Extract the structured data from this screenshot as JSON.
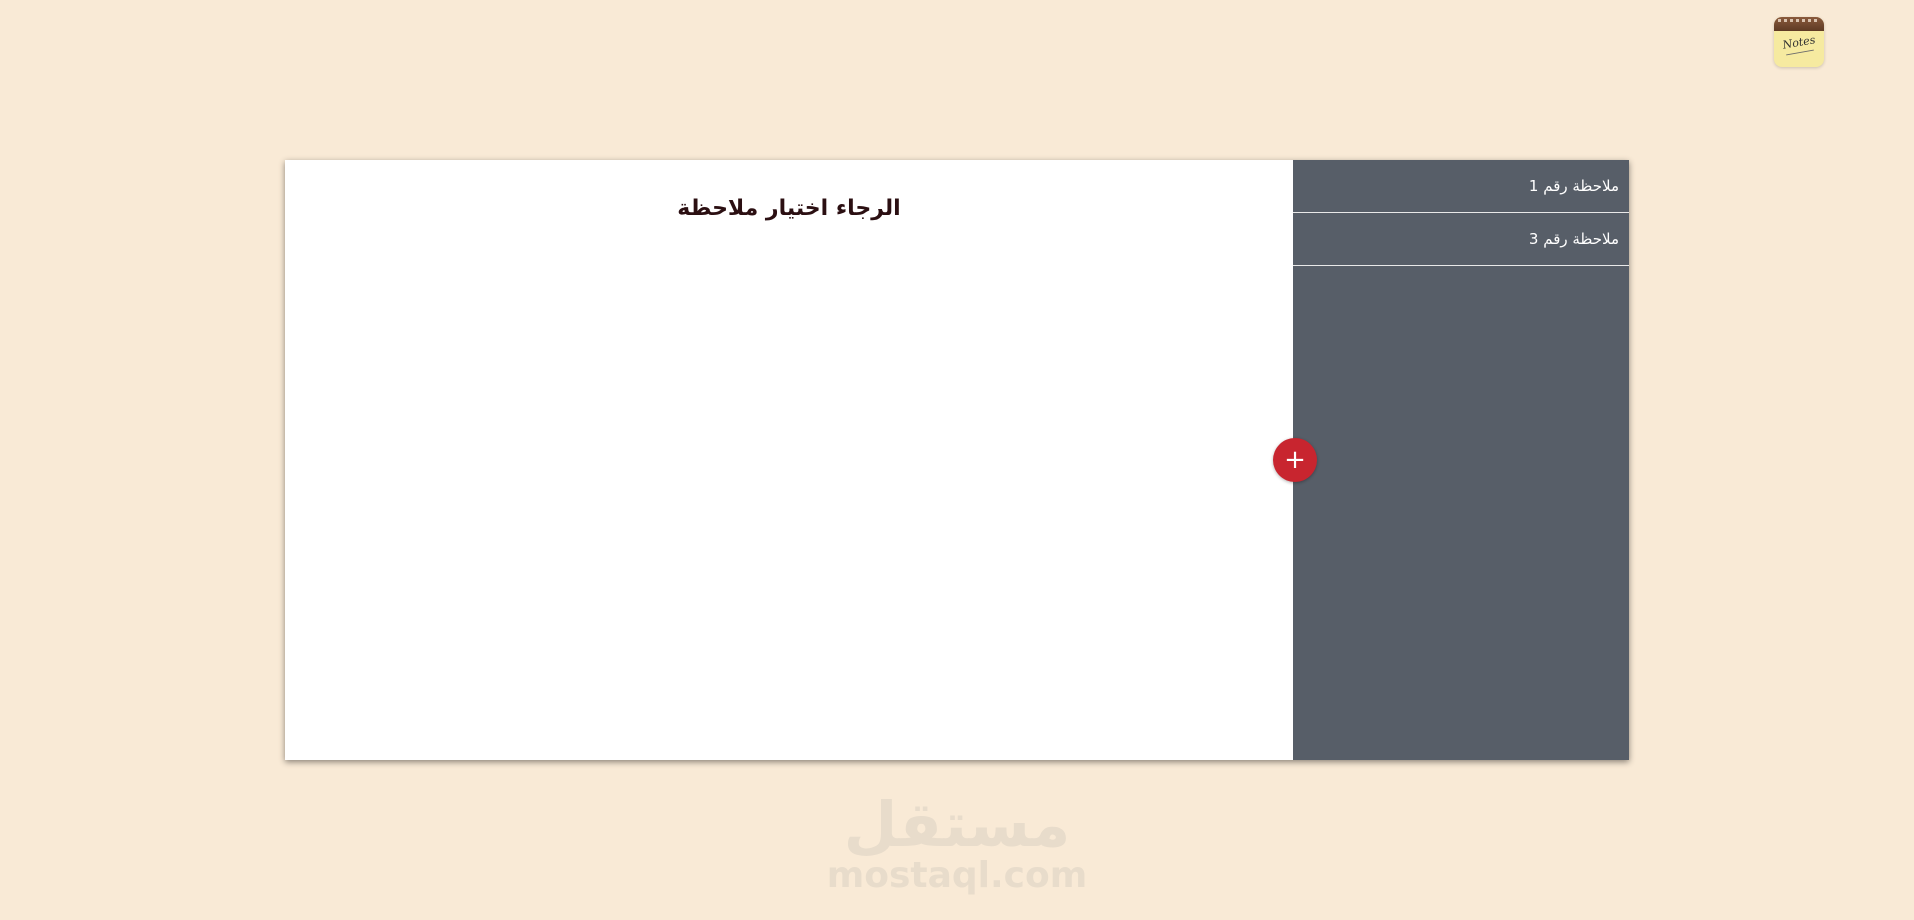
{
  "app": {
    "logo_text": "Notes"
  },
  "main": {
    "placeholder_title": "الرجاء اختيار ملاحظة",
    "add_button_label": "+"
  },
  "sidebar": {
    "items": [
      {
        "label": "ملاحظة رقم 1"
      },
      {
        "label": "ملاحظة رقم 3"
      }
    ]
  },
  "watermark": {
    "arabic": "مستقل",
    "latin": "mostaql.com"
  },
  "colors": {
    "background": "#f9ead6",
    "sidebar": "#575e68",
    "accent": "#c8252f",
    "title_text": "#2b0f12"
  },
  "icons": {
    "app_logo": "notes-notepad-icon",
    "add": "plus-icon"
  }
}
